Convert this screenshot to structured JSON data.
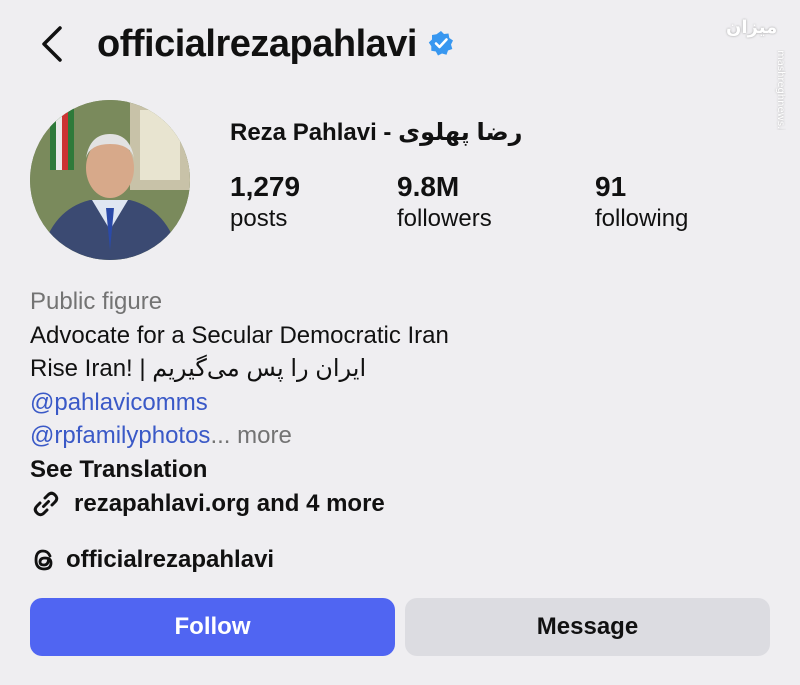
{
  "header": {
    "username": "officialrezapahlavi",
    "watermark": "میزان",
    "watermark_url": "mashreghnews.ir"
  },
  "profile": {
    "full_name": "Reza Pahlavi - رضا پهلوی",
    "stats": [
      {
        "value": "1,279",
        "label": "posts"
      },
      {
        "value": "9.8M",
        "label": "followers"
      },
      {
        "value": "91",
        "label": "following"
      }
    ]
  },
  "bio": {
    "category": "Public figure",
    "line1": "Advocate for a Secular Democratic Iran",
    "line2": "Rise Iran! | ایران را پس می‌گیریم",
    "mention1": "@pahlavicomms",
    "mention2": "@rpfamilyphotos",
    "more": "... more",
    "see_translation": "See Translation",
    "link": "rezapahlavi.org and 4 more",
    "threads": "officialrezapahlavi"
  },
  "actions": {
    "follow": "Follow",
    "message": "Message"
  },
  "colors": {
    "background": "#efeef1",
    "verified": "#3897f0",
    "follow_button": "#5065f2",
    "message_button": "#dcdce1",
    "mention": "#3a59c7"
  }
}
